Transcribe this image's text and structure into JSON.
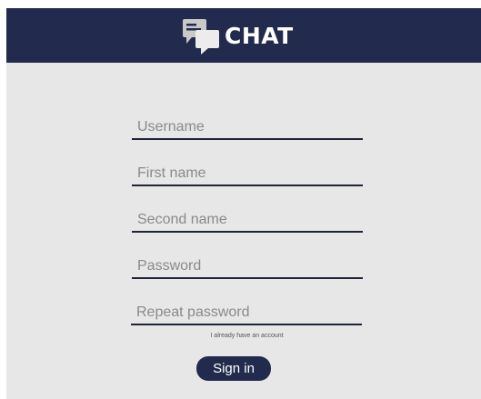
{
  "header": {
    "brand": "CHAT",
    "logo_icon": "chat-bubbles-icon",
    "background_color": "#222b4d"
  },
  "form": {
    "fields": [
      {
        "placeholder": "Username",
        "value": ""
      },
      {
        "placeholder": "First name",
        "value": ""
      },
      {
        "placeholder": "Second name",
        "value": ""
      },
      {
        "placeholder": "Password",
        "value": ""
      },
      {
        "placeholder": "Repeat password",
        "value": ""
      }
    ],
    "account_link": "I already have an account",
    "submit_label": "Sign in"
  },
  "colors": {
    "background": "#e7e7e7",
    "accent": "#222b4d"
  }
}
